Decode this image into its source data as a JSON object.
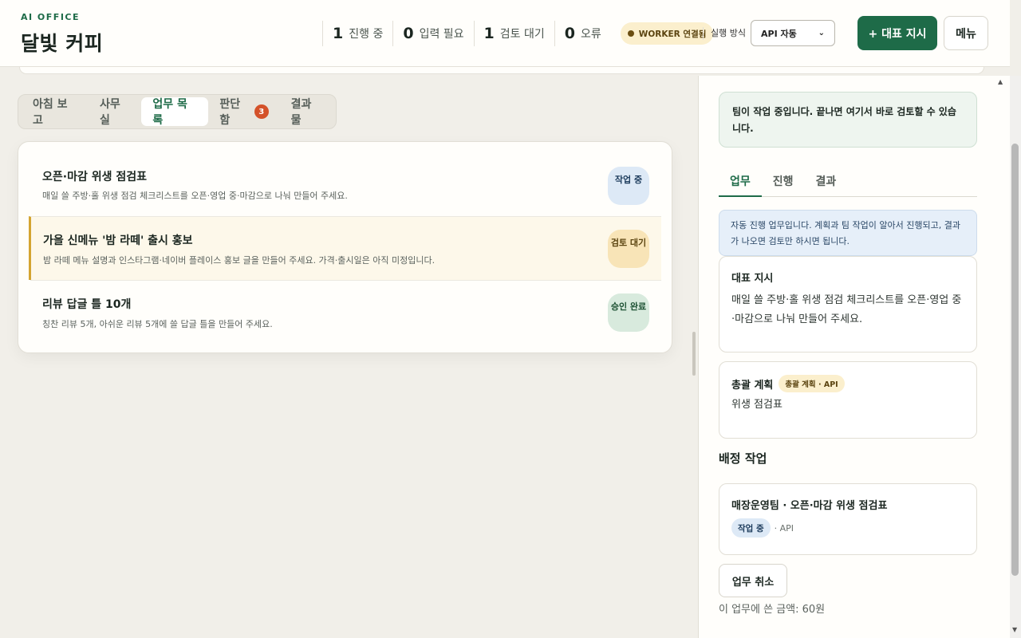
{
  "header": {
    "brand_sub": "AI OFFICE",
    "brand_title": "달빛 커피",
    "stats": [
      {
        "num": "1",
        "label": "진행 중"
      },
      {
        "num": "0",
        "label": "입력 필요"
      },
      {
        "num": "1",
        "label": "검토 대기"
      },
      {
        "num": "0",
        "label": "오류"
      }
    ],
    "worker_badge": "WORKER 연결됨",
    "mode_label": "실행 방식",
    "mode_value": "API 자동",
    "primary_button": "+ 대표 지시",
    "menu_button": "메뉴"
  },
  "tabs": [
    {
      "label": "아침 보고"
    },
    {
      "label": "사무실"
    },
    {
      "label": "업무 목록"
    },
    {
      "label": "판단함",
      "count": "3"
    },
    {
      "label": "결과물"
    }
  ],
  "tasks": [
    {
      "title": "오픈·마감 위생 점검표",
      "desc": "매일 쓸 주방·홀 위생 점검 체크리스트를 오픈·영업 중·마감으로 나눠 만들어 주세요.",
      "status": "작업 중"
    },
    {
      "title": "가을 신메뉴 '밤 라떼' 출시 홍보",
      "desc": "밤 라떼 메뉴 설명과 인스타그램·네이버 플레이스 홍보 글을 만들어 주세요. 가격·출시일은 아직 미정입니다.",
      "status": "검토 대기"
    },
    {
      "title": "리뷰 답글 틀 10개",
      "desc": "칭찬 리뷰 5개, 아쉬운 리뷰 5개에 쓸 답글 틀을 만들어 주세요.",
      "status": "승인 완료"
    }
  ],
  "panel": {
    "notice": "팀이 작업 중입니다. 끝나면 여기서 바로 검토할 수 있습니다.",
    "tabs": [
      "업무",
      "진행",
      "결과"
    ],
    "auto_note": "자동 진행 업무입니다. 계획과 팀 작업이 알아서 진행되고, 결과가 나오면 검토만 하시면 됩니다.",
    "directive_title": "대표 지시",
    "directive_body": "매일 쓸 주방·홀 위생 점검 체크리스트를 오픈·영업 중·마감으로 나눠 만들어 주세요.",
    "plan_title": "총괄 계획",
    "plan_tag": "총괄 계획 · API",
    "plan_body": "위생 점검표",
    "assign_section": "배정 작업",
    "assign_title": "매장운영팀 · 오픈·마감 위생 점검표",
    "assign_status": "작업 중",
    "assign_meta": "· API",
    "cancel_button": "업무 취소",
    "cost": "이 업무에 쓴 금액: 60원"
  },
  "colors": {
    "accent": "#1e6b48",
    "danger": "#d4522a",
    "review": "#d4a431"
  }
}
